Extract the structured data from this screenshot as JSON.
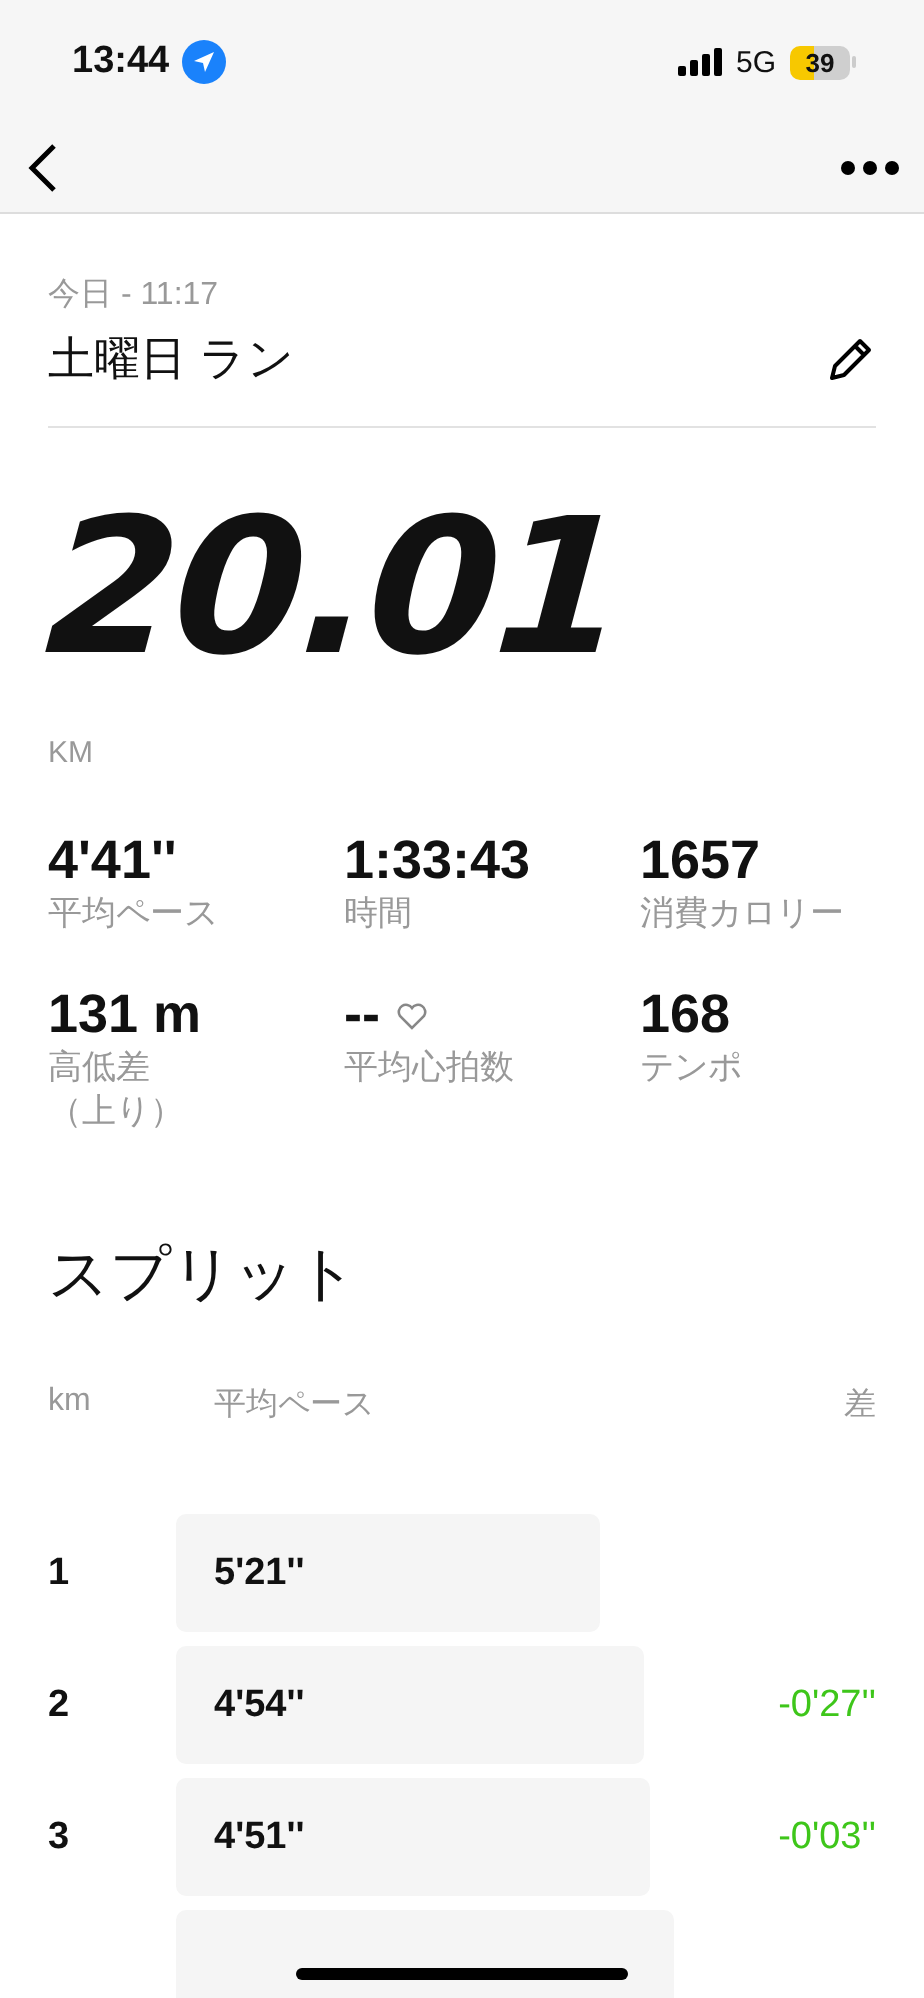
{
  "status_bar": {
    "time": "13:44",
    "network": "5G",
    "battery": "39"
  },
  "header": {
    "date": "今日 - 11:17",
    "title": "土曜日 ラン"
  },
  "distance": {
    "value": "20.01",
    "unit": "KM"
  },
  "stats": [
    {
      "value": "4'41''",
      "label": "平均ペース",
      "heart": false
    },
    {
      "value": "1:33:43",
      "label": "時間",
      "heart": false
    },
    {
      "value": "1657",
      "label": "消費カロリー",
      "heart": false
    },
    {
      "value": "131 m",
      "label": "高低差",
      "sublabel": "（上り）",
      "heart": false
    },
    {
      "value": "--",
      "label": "平均心拍数",
      "heart": true
    },
    {
      "value": "168",
      "label": "テンポ",
      "heart": false
    }
  ],
  "splits": {
    "title": "スプリット",
    "columns": [
      "km",
      "平均ペース",
      "差"
    ],
    "rows": [
      {
        "km": "1",
        "pace": "5'21''"
      },
      {
        "km": "2",
        "pace": "4'54''",
        "diff": "-0'27''"
      },
      {
        "km": "3",
        "pace": "4'51''",
        "diff": "-0'03''"
      }
    ]
  }
}
